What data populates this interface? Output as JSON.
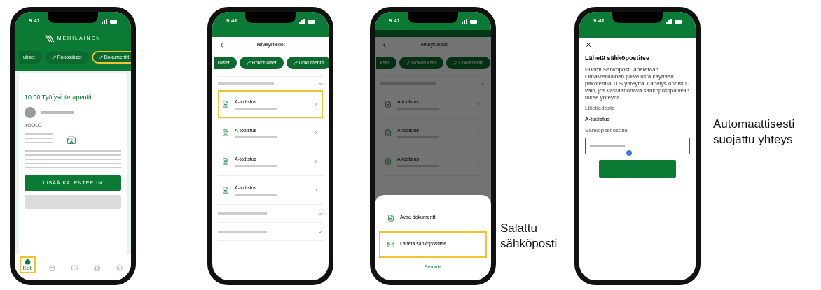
{
  "screens": [
    {
      "kind": "home",
      "time": "9:41",
      "logo": "MEHILÄINEN",
      "chips": [
        {
          "label": "ukset",
          "highlighted": false
        },
        {
          "label": "Rokotukset",
          "highlighted": false
        },
        {
          "label": "Dokumentit",
          "highlighted": true
        }
      ],
      "card": {
        "title": "10:00 Työfysioterapeutti",
        "location": "TÖÖLÖ",
        "primary_button": "LISÄÄ KALENTERIIN"
      },
      "nav": [
        {
          "label": "Koti",
          "selected": true,
          "highlighted": true
        },
        {
          "selected": false,
          "highlighted": false
        },
        {
          "selected": false,
          "highlighted": false
        },
        {
          "selected": false,
          "highlighted": false
        },
        {
          "selected": false,
          "highlighted": false
        }
      ]
    },
    {
      "kind": "documents",
      "time": "9:41",
      "title": "Terveystiedot",
      "chips": [
        {
          "label": "ukset",
          "highlighted": false
        },
        {
          "label": "Rokotukset",
          "highlighted": false
        },
        {
          "label": "Dokumentit",
          "highlighted": false
        }
      ],
      "documents": [
        {
          "name": "A-todistus",
          "highlighted": true
        },
        {
          "name": "A-todistus",
          "highlighted": false
        },
        {
          "name": "A-todistus",
          "highlighted": false
        },
        {
          "name": "A-todistus",
          "highlighted": false
        }
      ],
      "sections": [
        {
          "expanded": false
        },
        {
          "expanded": false
        }
      ],
      "dimmed": false
    },
    {
      "kind": "documents",
      "time": "9:41",
      "title": "Terveystiedot",
      "chips": [
        {
          "label": "kset",
          "highlighted": false
        },
        {
          "label": "Rokotukset",
          "highlighted": false
        },
        {
          "label": "Dokumentit",
          "highlighted": false
        }
      ],
      "documents": [
        {
          "name": "A-todistus",
          "highlighted": false
        },
        {
          "name": "A-todistus",
          "highlighted": false
        },
        {
          "name": "A-todistus",
          "highlighted": false
        }
      ],
      "dimmed": true,
      "sheet": {
        "options": [
          {
            "label": "Avaa dokumentti",
            "kind": "document",
            "highlighted": false
          },
          {
            "label": "Lähetä sähköpostitse",
            "kind": "mail",
            "highlighted": true
          }
        ],
        "cancel": "Peruuta"
      },
      "annotation": "Salattu sähköposti"
    },
    {
      "kind": "email",
      "time": "9:41",
      "heading": "Lähetä sähköpostitse",
      "notice": "Huom! Sähköposti lähetetään OmaMehiläinen palvelusta käyttäen pakotettua TLS yhteyttä. Lähetys onnistuu vain, jos vastaanottava sähköpostipalvelin tukee yhteyttä.",
      "attachment_label": "Liitetiedosto",
      "attachment": "A-todistus",
      "email_label": "Sähköpostiosoite",
      "annotation": "Automaattisesti suojattu yhteys"
    }
  ]
}
